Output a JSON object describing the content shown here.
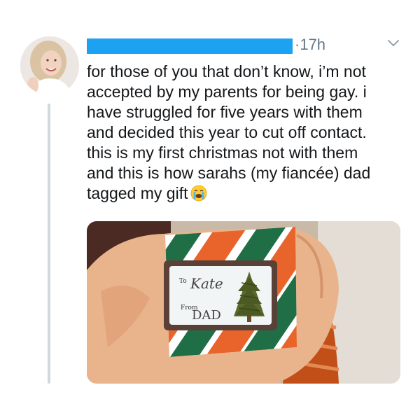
{
  "tweet": {
    "time_separator": "·",
    "time": "17h",
    "text_lines": [
      "for those of you that don’t know, i’m not",
      "accepted by my parents for being gay. i",
      "have struggled for five years with them",
      "and decided this year to cut off contact.",
      "this is my first christmas not with them",
      "and this is how sarahs (my fiancée) dad",
      "tagged my gift"
    ],
    "emoji": "crying-face-emoji"
  },
  "photo": {
    "tag_to_label": "To",
    "tag_to_name": "Kate",
    "tag_from_label": "From",
    "tag_from_name": "DAD"
  },
  "colors": {
    "redaction_blue": "#1da1f2",
    "meta_gray": "#657786",
    "text_black": "#14171a",
    "thread_line": "#cfd9de"
  }
}
